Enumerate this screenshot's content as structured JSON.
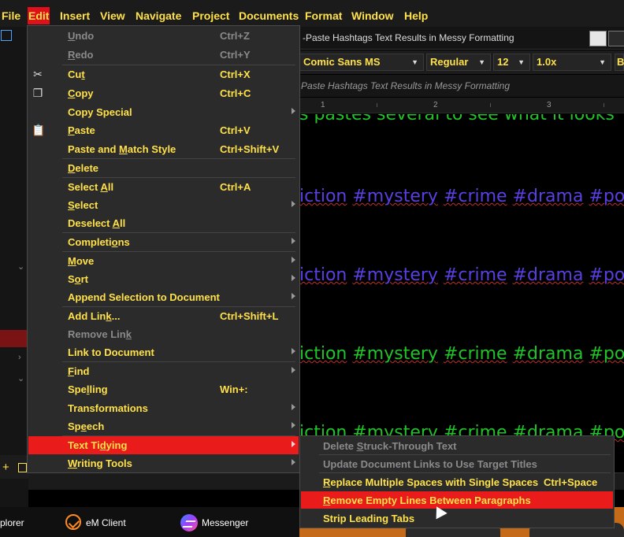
{
  "menubar": {
    "items": [
      {
        "key": "file",
        "label": "File"
      },
      {
        "key": "edit",
        "label": "Edit"
      },
      {
        "key": "insert",
        "label": "Insert"
      },
      {
        "key": "view",
        "label": "View"
      },
      {
        "key": "navigate",
        "label": "Navigate"
      },
      {
        "key": "project",
        "label": "Project"
      },
      {
        "key": "documents",
        "label": "Documents"
      },
      {
        "key": "format",
        "label": "Format"
      },
      {
        "key": "window",
        "label": "Window"
      },
      {
        "key": "help",
        "label": "Help"
      }
    ]
  },
  "editor": {
    "title": "-Paste Hashtags Text Results in Messy Formatting",
    "subtitle": "Paste Hashtags Text Results in Messy Formatting",
    "font_family": "Comic Sans MS",
    "font_style": "Regular",
    "font_size": "12",
    "line_spacing": "1.0x",
    "extra_button": "B",
    "ruler": [
      "1",
      "2",
      "3"
    ],
    "lines": [
      {
        "text": "s pastes several to see what it looks",
        "color": "#22c32a"
      },
      {
        "text": "iction #mystery #crime #drama #po",
        "color": "#5b3fe0"
      },
      {
        "text": "iction #mystery #crime #drama #po",
        "color": "#5b3fe0"
      },
      {
        "text": "iction #mystery #crime #drama #po",
        "color": "#22c32a"
      },
      {
        "text": "iction #mystery #crime #drama #po",
        "color": "#22c32a"
      }
    ]
  },
  "edit_menu": {
    "items": [
      {
        "label": "Undo",
        "shortcut": "Ctrl+Z",
        "disabled": true
      },
      {
        "label": "Redo",
        "shortcut": "Ctrl+Y",
        "disabled": true
      },
      {
        "label": "Cut",
        "shortcut": "Ctrl+X",
        "icon": "scissors-icon"
      },
      {
        "label": "Copy",
        "shortcut": "Ctrl+C",
        "icon": "copy-icon"
      },
      {
        "label": "Copy Special",
        "submenu": true
      },
      {
        "label": "Paste",
        "shortcut": "Ctrl+V",
        "icon": "paste-icon"
      },
      {
        "label": "Paste and Match Style",
        "shortcut": "Ctrl+Shift+V"
      },
      {
        "label": "Delete"
      },
      {
        "label": "Select All",
        "shortcut": "Ctrl+A"
      },
      {
        "label": "Select",
        "submenu": true
      },
      {
        "label": "Deselect All"
      },
      {
        "label": "Completions",
        "submenu": true
      },
      {
        "label": "Move",
        "submenu": true
      },
      {
        "label": "Sort",
        "submenu": true
      },
      {
        "label": "Append Selection to Document",
        "submenu": true
      },
      {
        "label": "Add Link...",
        "shortcut": "Ctrl+Shift+L"
      },
      {
        "label": "Remove Link",
        "disabled": true
      },
      {
        "label": "Link to Document",
        "submenu": true
      },
      {
        "label": "Find",
        "submenu": true
      },
      {
        "label": "Spelling",
        "shortcut": "Win+:"
      },
      {
        "label": "Transformations",
        "submenu": true
      },
      {
        "label": "Speech",
        "submenu": true
      },
      {
        "label": "Text Tidying",
        "submenu": true,
        "highlighted": true
      },
      {
        "label": "Writing Tools",
        "submenu": true
      }
    ]
  },
  "text_tidying_submenu": {
    "items": [
      {
        "label": "Delete Struck-Through Text",
        "disabled": true
      },
      {
        "label": "Update Document Links to Use Target Titles",
        "disabled": true
      },
      {
        "label": "Replace Multiple Spaces with Single Spaces",
        "shortcut": "Ctrl+Space"
      },
      {
        "label": "Remove Empty Lines Between Paragraphs",
        "highlighted": true
      },
      {
        "label": "Strip Leading Tabs"
      }
    ]
  },
  "taskbar": {
    "items": [
      {
        "label": "plorer"
      },
      {
        "label": "eM Client"
      },
      {
        "label": "Messenger"
      }
    ]
  },
  "colors": {
    "menu_text": "#ffe14a",
    "highlight": "#ea1b1b",
    "disabled": "#8a8a8a",
    "menu_bg": "#2b2b2b"
  }
}
